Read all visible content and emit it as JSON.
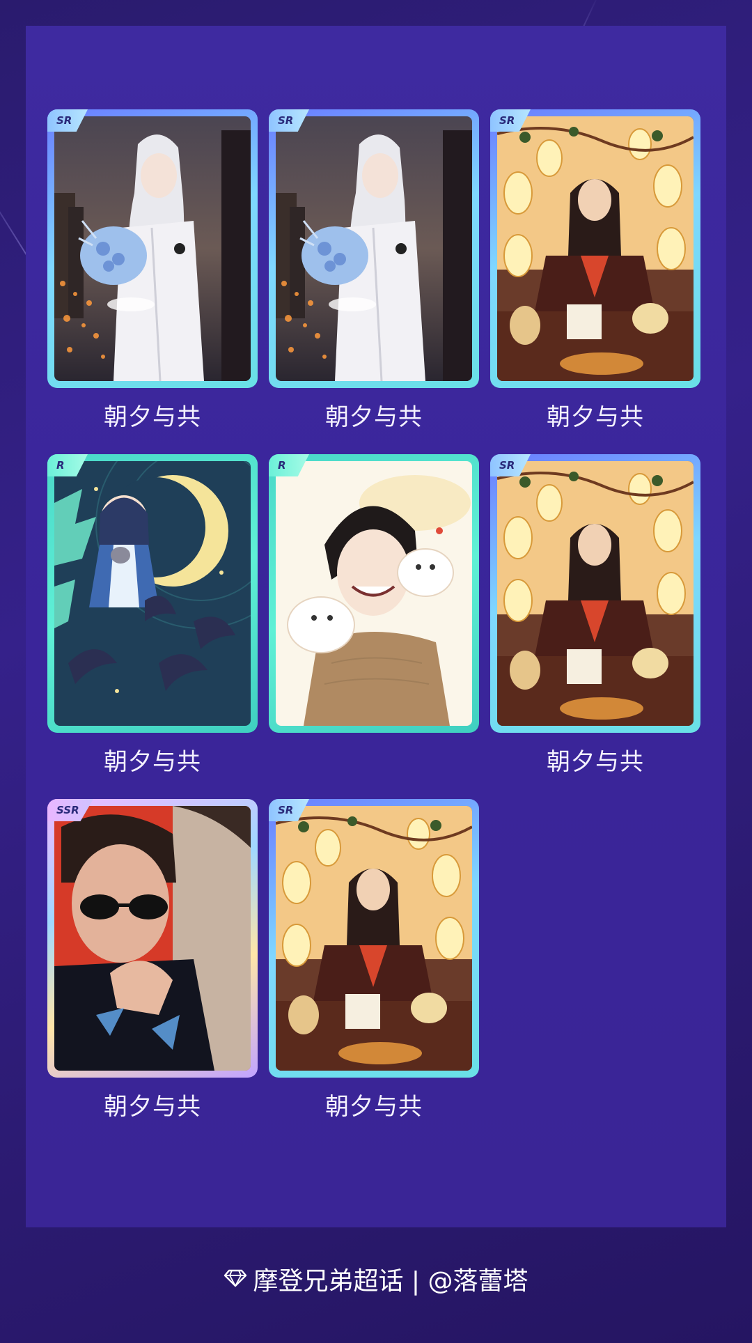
{
  "cards": [
    {
      "rarity": "SR",
      "caption": "朝夕与共",
      "art": "silver-hair-bouquet"
    },
    {
      "rarity": "SR",
      "caption": "朝夕与共",
      "art": "silver-hair-bouquet"
    },
    {
      "rarity": "SR",
      "caption": "朝夕与共",
      "art": "lantern-scholar"
    },
    {
      "rarity": "R",
      "caption": "朝夕与共",
      "art": "chibi-moon"
    },
    {
      "rarity": "R",
      "caption": "",
      "art": "smiling-with-birds"
    },
    {
      "rarity": "SR",
      "caption": "朝夕与共",
      "art": "lantern-scholar"
    },
    {
      "rarity": "SSR",
      "caption": "朝夕与共",
      "art": "sunglasses-portrait"
    },
    {
      "rarity": "SR",
      "caption": "朝夕与共",
      "art": "lantern-scholar"
    }
  ],
  "footer": {
    "icon": "diamond-icon",
    "text": "摩登兄弟超话 | @落蕾塔"
  },
  "colors": {
    "background": "#2f1e7e",
    "panel": "#3c279c",
    "caption": "#f4f1ff"
  }
}
